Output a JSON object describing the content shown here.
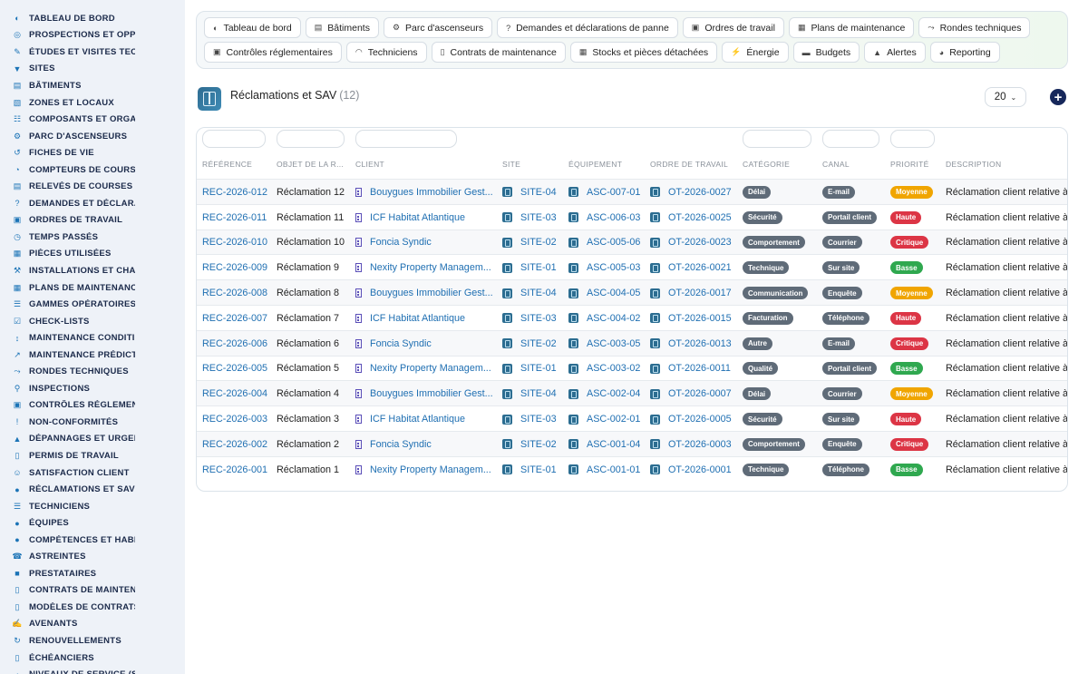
{
  "sidebar": {
    "items": [
      {
        "label": "TABLEAU DE BORD",
        "icon": "dashboard-icon"
      },
      {
        "label": "PROSPECTIONS ET OPPORTUNITÉS",
        "icon": "target-icon"
      },
      {
        "label": "ÉTUDES ET VISITES TECHNIQUES",
        "icon": "pen-ruler-icon"
      },
      {
        "label": "SITES",
        "icon": "map-pin-icon"
      },
      {
        "label": "BÂTIMENTS",
        "icon": "building-icon"
      },
      {
        "label": "ZONES ET LOCAUX",
        "icon": "layers-icon"
      },
      {
        "label": "COMPOSANTS ET ORGANES",
        "icon": "sitemap-icon"
      },
      {
        "label": "PARC D'ASCENSEURS",
        "icon": "gears-icon"
      },
      {
        "label": "FICHES DE VIE",
        "icon": "history-icon"
      },
      {
        "label": "COMPTEURS DE COURSES",
        "icon": "gauge-icon"
      },
      {
        "label": "RELEVÉS DE COURSES",
        "icon": "document-icon"
      },
      {
        "label": "DEMANDES ET DÉCLARATIONS",
        "icon": "question-icon"
      },
      {
        "label": "ORDRES DE TRAVAIL",
        "icon": "clipboard-icon"
      },
      {
        "label": "TEMPS PASSÉS",
        "icon": "clock-icon"
      },
      {
        "label": "PIÈCES UTILISÉES",
        "icon": "boxes-icon"
      },
      {
        "label": "INSTALLATIONS ET CHANTIERS",
        "icon": "tools-icon"
      },
      {
        "label": "PLANS DE MAINTENANCE",
        "icon": "calendar-icon"
      },
      {
        "label": "GAMMES OPÉRATOIRES",
        "icon": "list-icon"
      },
      {
        "label": "CHECK-LISTS",
        "icon": "checklist-icon"
      },
      {
        "label": "MAINTENANCE CONDITIONNELLE",
        "icon": "thermometer-icon"
      },
      {
        "label": "MAINTENANCE PRÉDICTIVE",
        "icon": "chart-icon"
      },
      {
        "label": "RONDES TECHNIQUES",
        "icon": "route-icon"
      },
      {
        "label": "INSPECTIONS",
        "icon": "search-icon"
      },
      {
        "label": "CONTRÔLES RÉGLEMENTAIRES",
        "icon": "stamp-icon"
      },
      {
        "label": "NON-CONFORMITÉS",
        "icon": "alert-circle-icon"
      },
      {
        "label": "DÉPANNAGES ET URGENCES",
        "icon": "warning-icon"
      },
      {
        "label": "PERMIS DE TRAVAIL",
        "icon": "file-icon"
      },
      {
        "label": "SATISFACTION CLIENT",
        "icon": "smile-icon"
      },
      {
        "label": "RÉCLAMATIONS ET SAV",
        "icon": "comments-icon"
      },
      {
        "label": "TECHNICIENS",
        "icon": "list-icon"
      },
      {
        "label": "ÉQUIPES",
        "icon": "users-icon"
      },
      {
        "label": "COMPÉTENCES ET HABILITATIONS",
        "icon": "badge-icon"
      },
      {
        "label": "ASTREINTES",
        "icon": "phone-icon"
      },
      {
        "label": "PRESTATAIRES",
        "icon": "briefcase-icon"
      },
      {
        "label": "CONTRATS DE MAINTENANCE",
        "icon": "file-contract-icon"
      },
      {
        "label": "MODÈLES DE CONTRATS",
        "icon": "file-icon"
      },
      {
        "label": "AVENANTS",
        "icon": "file-signature-icon"
      },
      {
        "label": "RENOUVELLEMENTS",
        "icon": "refresh-icon"
      },
      {
        "label": "ÉCHÉANCIERS",
        "icon": "file-icon"
      },
      {
        "label": "NIVEAUX DE SERVICE (SLA)",
        "icon": "gauge-icon"
      }
    ]
  },
  "nav": {
    "row1": [
      {
        "label": "Tableau de bord",
        "icon": "dashboard-icon"
      },
      {
        "label": "Bâtiments",
        "icon": "building-icon"
      },
      {
        "label": "Parc d'ascenseurs",
        "icon": "gears-icon"
      },
      {
        "label": "Demandes et déclarations de panne",
        "icon": "question-icon"
      },
      {
        "label": "Ordres de travail",
        "icon": "clipboard-icon"
      },
      {
        "label": "Plans de maintenance",
        "icon": "calendar-icon"
      },
      {
        "label": "Rondes techniques",
        "icon": "route-icon"
      }
    ],
    "row2": [
      {
        "label": "Contrôles réglementaires",
        "icon": "stamp-icon"
      },
      {
        "label": "Techniciens",
        "icon": "hardhat-icon"
      },
      {
        "label": "Contrats de maintenance",
        "icon": "file-contract-icon"
      },
      {
        "label": "Stocks et pièces détachées",
        "icon": "boxes-icon"
      },
      {
        "label": "Énergie",
        "icon": "bolt-icon"
      },
      {
        "label": "Budgets",
        "icon": "money-icon"
      },
      {
        "label": "Alertes",
        "icon": "bell-icon"
      },
      {
        "label": "Reporting",
        "icon": "pie-chart-icon"
      }
    ]
  },
  "page": {
    "title": "Réclamations et SAV",
    "count": "(12)",
    "page_size": "20",
    "add_label": "+"
  },
  "table": {
    "headers": [
      "RÉFÉRENCE",
      "OBJET DE LA R...",
      "CLIENT",
      "SITE",
      "ÉQUIPEMENT",
      "ORDRE DE TRAVAIL",
      "CATÉGORIE",
      "CANAL",
      "PRIORITÉ",
      "DESCRIPTION"
    ],
    "rows": [
      {
        "ref": "REC-2026-012",
        "objet": "Réclamation 12",
        "client": "Bouygues Immobilier Gest...",
        "site": "SITE-04",
        "equip": "ASC-007-01",
        "ot": "OT-2026-0027",
        "categorie": "Délai",
        "canal": "E-mail",
        "priorite": "Moyenne",
        "description": "Réclamation client relative à"
      },
      {
        "ref": "REC-2026-011",
        "objet": "Réclamation 11",
        "client": "ICF Habitat Atlantique",
        "site": "SITE-03",
        "equip": "ASC-006-03",
        "ot": "OT-2026-0025",
        "categorie": "Sécurité",
        "canal": "Portail client",
        "priorite": "Haute",
        "description": "Réclamation client relative à"
      },
      {
        "ref": "REC-2026-010",
        "objet": "Réclamation 10",
        "client": "Foncia Syndic",
        "site": "SITE-02",
        "equip": "ASC-005-06",
        "ot": "OT-2026-0023",
        "categorie": "Comportement",
        "canal": "Courrier",
        "priorite": "Critique",
        "description": "Réclamation client relative à"
      },
      {
        "ref": "REC-2026-009",
        "objet": "Réclamation 9",
        "client": "Nexity Property Managem...",
        "site": "SITE-01",
        "equip": "ASC-005-03",
        "ot": "OT-2026-0021",
        "categorie": "Technique",
        "canal": "Sur site",
        "priorite": "Basse",
        "description": "Réclamation client relative à"
      },
      {
        "ref": "REC-2026-008",
        "objet": "Réclamation 8",
        "client": "Bouygues Immobilier Gest...",
        "site": "SITE-04",
        "equip": "ASC-004-05",
        "ot": "OT-2026-0017",
        "categorie": "Communication",
        "canal": "Enquête",
        "priorite": "Moyenne",
        "description": "Réclamation client relative à"
      },
      {
        "ref": "REC-2026-007",
        "objet": "Réclamation 7",
        "client": "ICF Habitat Atlantique",
        "site": "SITE-03",
        "equip": "ASC-004-02",
        "ot": "OT-2026-0015",
        "categorie": "Facturation",
        "canal": "Téléphone",
        "priorite": "Haute",
        "description": "Réclamation client relative à"
      },
      {
        "ref": "REC-2026-006",
        "objet": "Réclamation 6",
        "client": "Foncia Syndic",
        "site": "SITE-02",
        "equip": "ASC-003-05",
        "ot": "OT-2026-0013",
        "categorie": "Autre",
        "canal": "E-mail",
        "priorite": "Critique",
        "description": "Réclamation client relative à"
      },
      {
        "ref": "REC-2026-005",
        "objet": "Réclamation 5",
        "client": "Nexity Property Managem...",
        "site": "SITE-01",
        "equip": "ASC-003-02",
        "ot": "OT-2026-0011",
        "categorie": "Qualité",
        "canal": "Portail client",
        "priorite": "Basse",
        "description": "Réclamation client relative à"
      },
      {
        "ref": "REC-2026-004",
        "objet": "Réclamation 4",
        "client": "Bouygues Immobilier Gest...",
        "site": "SITE-04",
        "equip": "ASC-002-04",
        "ot": "OT-2026-0007",
        "categorie": "Délai",
        "canal": "Courrier",
        "priorite": "Moyenne",
        "description": "Réclamation client relative à"
      },
      {
        "ref": "REC-2026-003",
        "objet": "Réclamation 3",
        "client": "ICF Habitat Atlantique",
        "site": "SITE-03",
        "equip": "ASC-002-01",
        "ot": "OT-2026-0005",
        "categorie": "Sécurité",
        "canal": "Sur site",
        "priorite": "Haute",
        "description": "Réclamation client relative à"
      },
      {
        "ref": "REC-2026-002",
        "objet": "Réclamation 2",
        "client": "Foncia Syndic",
        "site": "SITE-02",
        "equip": "ASC-001-04",
        "ot": "OT-2026-0003",
        "categorie": "Comportement",
        "canal": "Enquête",
        "priorite": "Critique",
        "description": "Réclamation client relative à"
      },
      {
        "ref": "REC-2026-001",
        "objet": "Réclamation 1",
        "client": "Nexity Property Managem...",
        "site": "SITE-01",
        "equip": "ASC-001-01",
        "ot": "OT-2026-0001",
        "categorie": "Technique",
        "canal": "Téléphone",
        "priorite": "Basse",
        "description": "Réclamation client relative à"
      }
    ]
  },
  "colors": {
    "link": "#1f6fb2",
    "badge_gray": "#5f6b78",
    "priority_moyenne": "#f0a500",
    "priority_haute": "#dc3545",
    "priority_critique": "#dc3545",
    "priority_basse": "#2fa84f",
    "add_button": "#16275a",
    "sidebar_bg": "#eef2f8"
  }
}
